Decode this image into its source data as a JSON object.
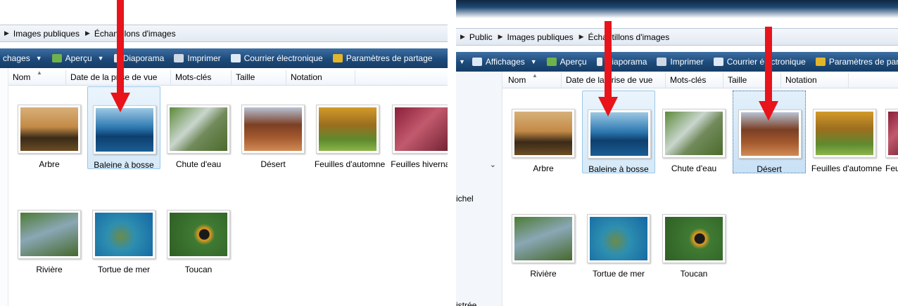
{
  "left": {
    "breadcrumb": [
      "Images publiques",
      "Échantillons d'images"
    ],
    "toolbar": [
      {
        "label": "chages",
        "icon": "views-icon",
        "dropdown": true
      },
      {
        "label": "Aperçu",
        "icon": "preview-icon",
        "dropdown": true
      },
      {
        "label": "Diaporama",
        "icon": "slideshow-icon",
        "dropdown": false
      },
      {
        "label": "Imprimer",
        "icon": "printer-icon",
        "dropdown": false
      },
      {
        "label": "Courrier électronique",
        "icon": "email-icon",
        "dropdown": false
      },
      {
        "label": "Paramètres de partage",
        "icon": "share-icon",
        "dropdown": false
      }
    ],
    "columns": [
      "Nom",
      "Date de la prise de vue",
      "Mots-clés",
      "Taille",
      "Notation"
    ],
    "items": [
      "Arbre",
      "Baleine à bosse",
      "Chute d'eau",
      "Désert",
      "Feuilles d'automne",
      "Feuilles hivernales",
      "Rivière",
      "Tortue de mer",
      "Toucan"
    ],
    "selected": "Baleine à bosse"
  },
  "right": {
    "breadcrumb": [
      "Public",
      "Images publiques",
      "Échantillons d'images"
    ],
    "toolbar": [
      {
        "label": "Affichages",
        "icon": "views-icon",
        "dropdown": true
      },
      {
        "label": "Aperçu",
        "icon": "preview-icon",
        "dropdown": false
      },
      {
        "label": "Diaporama",
        "icon": "slideshow-icon",
        "dropdown": false
      },
      {
        "label": "Imprimer",
        "icon": "printer-icon",
        "dropdown": false
      },
      {
        "label": "Courrier électronique",
        "icon": "email-icon",
        "dropdown": false
      },
      {
        "label": "Paramètres de partage",
        "icon": "share-icon",
        "dropdown": false
      }
    ],
    "columns": [
      "Nom",
      "Date de la prise de vue",
      "Mots-clés",
      "Taille",
      "Notation"
    ],
    "nav": {
      "fragment_1": "ichel",
      "fragment_2": "istrée"
    },
    "items": [
      "Arbre",
      "Baleine à bosse",
      "Chute d'eau",
      "Désert",
      "Feuilles d'automne",
      "Feu",
      "Rivière",
      "Tortue de mer",
      "Toucan"
    ],
    "selected": [
      "Baleine à bosse",
      "Désert"
    ]
  },
  "colors": {
    "annotation_arrow": "#e8131b",
    "toolbar": "#1d4a7a",
    "selection": "#d6e9f8"
  }
}
